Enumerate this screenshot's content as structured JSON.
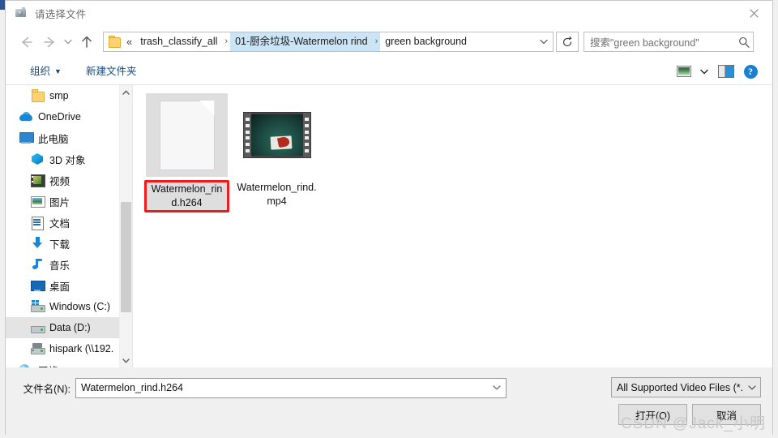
{
  "window": {
    "title": "请选择文件",
    "title_icon": "camera-icon",
    "close_label": "✕"
  },
  "nav": {
    "back_icon": "arrow-left-icon",
    "forward_icon": "arrow-right-icon",
    "recent_icon": "chevron-down-icon",
    "up_icon": "arrow-up-icon",
    "breadcrumb": {
      "folder_icon": "folder-icon",
      "overflow": "«",
      "separator": "›",
      "items": [
        {
          "label": "trash_classify_all",
          "selected": false
        },
        {
          "label": "01-厨余垃圾-Watermelon rind",
          "selected": true
        },
        {
          "label": "green background",
          "selected": false
        }
      ],
      "dropdown_icon": "chevron-down-icon"
    },
    "refresh_icon": "refresh-icon",
    "search": {
      "placeholder": "搜索\"green background\"",
      "icon": "search-icon"
    }
  },
  "toolbar": {
    "organize_label": "组织",
    "organize_caret": "▼",
    "new_folder_label": "新建文件夹",
    "view_icon": "view-layout-icon",
    "view_caret": "▼",
    "preview_pane_icon": "preview-pane-icon",
    "help_icon": "help-icon",
    "help_glyph": "?"
  },
  "sidebar": {
    "items": [
      {
        "label": "smp",
        "icon": "folder-icon",
        "indent": 30,
        "selected": false
      },
      {
        "label": "OneDrive",
        "icon": "cloud-icon",
        "indent": 16,
        "selected": false
      },
      {
        "label": "此电脑",
        "icon": "computer-icon",
        "indent": 16,
        "selected": false
      },
      {
        "label": "3D 对象",
        "icon": "3d-objects-icon",
        "indent": 30,
        "selected": false
      },
      {
        "label": "视频",
        "icon": "videos-icon",
        "indent": 30,
        "selected": false
      },
      {
        "label": "图片",
        "icon": "pictures-icon",
        "indent": 30,
        "selected": false
      },
      {
        "label": "文档",
        "icon": "documents-icon",
        "indent": 30,
        "selected": false
      },
      {
        "label": "下载",
        "icon": "downloads-icon",
        "indent": 30,
        "selected": false
      },
      {
        "label": "音乐",
        "icon": "music-icon",
        "indent": 30,
        "selected": false
      },
      {
        "label": "桌面",
        "icon": "desktop-icon",
        "indent": 30,
        "selected": false
      },
      {
        "label": "Windows (C:)",
        "icon": "drive-windows-icon",
        "indent": 30,
        "selected": false
      },
      {
        "label": "Data (D:)",
        "icon": "drive-icon",
        "indent": 30,
        "selected": true
      },
      {
        "label": "hispark (\\\\192.",
        "icon": "network-drive-icon",
        "indent": 30,
        "selected": false
      },
      {
        "label": "网络",
        "icon": "network-icon",
        "indent": 16,
        "selected": false
      }
    ],
    "scroll_up_icon": "chevron-up-icon",
    "scroll_down_icon": "chevron-down-icon"
  },
  "files": [
    {
      "name": "Watermelon_rind.h264",
      "thumb": "generic-document-icon",
      "selected": true
    },
    {
      "name": "Watermelon_rind.mp4",
      "thumb": "video-filmstrip-thumbnail",
      "selected": false
    }
  ],
  "footer": {
    "filename_label": "文件名(N):",
    "filename_value": "Watermelon_rind.h264",
    "filename_caret_icon": "chevron-down-icon",
    "filter_value": "All Supported Video Files (*.",
    "filter_caret_icon": "chevron-down-icon",
    "open_button": "打开(O)",
    "cancel_button": "取消"
  },
  "watermark": "CSDN @Jack_小明",
  "colors": {
    "selection_highlight": "#cce5f6",
    "selected_file_outline": "#ee1c1c",
    "toolbar_link": "#16487e",
    "accent_blue": "#1b7fd1"
  }
}
